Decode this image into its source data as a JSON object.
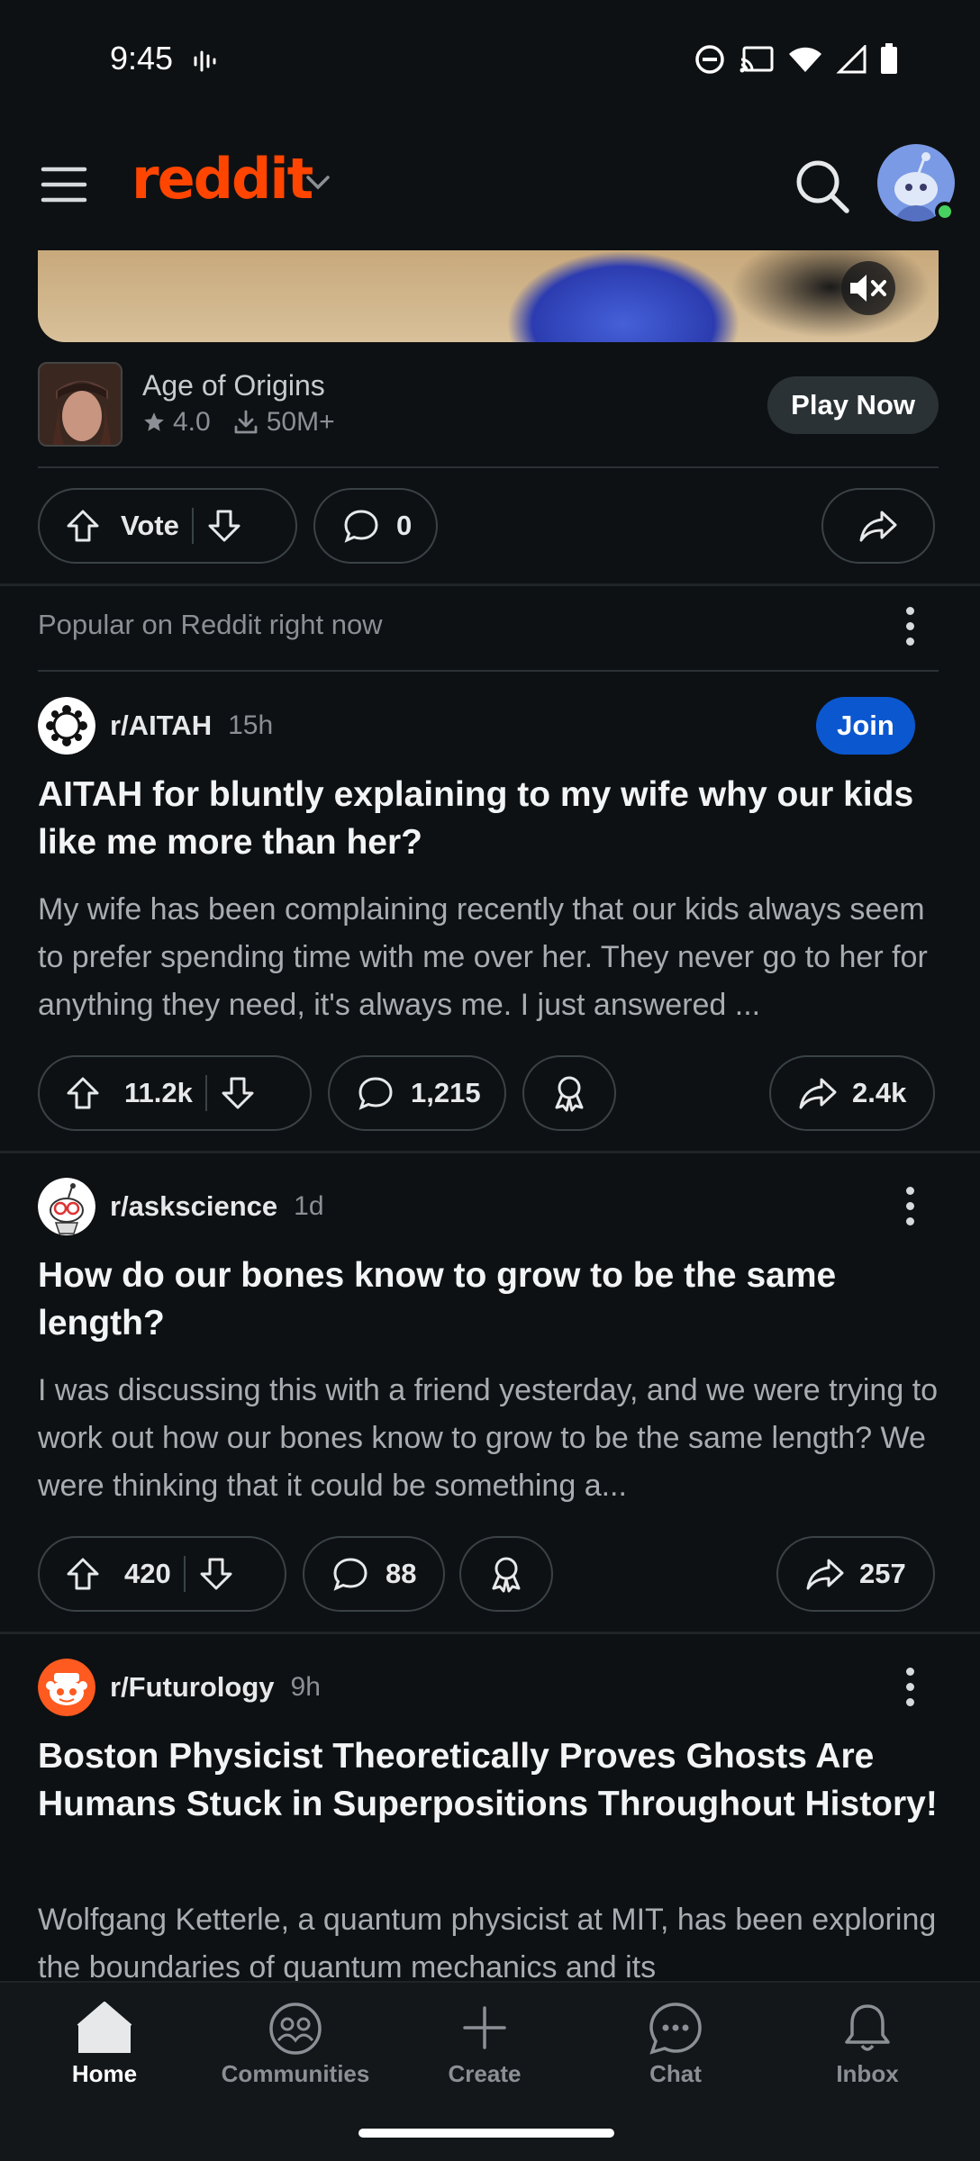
{
  "status_bar": {
    "time": "9:45",
    "icons": [
      "voice-wave-icon",
      "do-not-disturb-icon",
      "cast-icon",
      "wifi-icon",
      "signal-icon",
      "battery-icon"
    ]
  },
  "header": {
    "logo": "reddit",
    "logo_color": "#ff4500"
  },
  "ad": {
    "app_name": "Age of Origins",
    "rating": "4.0",
    "downloads": "50M+",
    "cta": "Play Now",
    "vote_label": "Vote",
    "comments": "0"
  },
  "feed": {
    "section_label": "Popular on Reddit right now"
  },
  "posts": [
    {
      "subreddit": "r/AITAH",
      "age": "15h",
      "join_label": "Join",
      "title": "AITAH for bluntly explaining to my wife why our kids like me more than her?",
      "body": "My wife has been complaining recently that our kids always seem to prefer spending time with me over her. They never go to her for anything they need, it's always me. I just answered ...",
      "votes": "11.2k",
      "comments": "1,215",
      "shares": "2.4k"
    },
    {
      "subreddit": "r/askscience",
      "age": "1d",
      "title": "How do our bones know to grow to be the same length?",
      "body": "I was discussing this with a friend yesterday, and we were trying to work out how our bones know to grow to be the same length? We were thinking that it could be something a...",
      "votes": "420",
      "comments": "88",
      "shares": "257"
    },
    {
      "subreddit": "r/Futurology",
      "age": "9h",
      "title": "Boston Physicist Theoretically Proves Ghosts Are Humans Stuck in Superpositions Throughout History!",
      "body": "Wolfgang Ketterle, a quantum physicist at MIT, has been exploring the boundaries of quantum mechanics and its"
    }
  ],
  "bottom_nav": [
    {
      "label": "Home",
      "icon": "home-icon",
      "active": true
    },
    {
      "label": "Communities",
      "icon": "communities-icon"
    },
    {
      "label": "Create",
      "icon": "plus-icon"
    },
    {
      "label": "Chat",
      "icon": "chat-icon"
    },
    {
      "label": "Inbox",
      "icon": "bell-icon"
    }
  ]
}
